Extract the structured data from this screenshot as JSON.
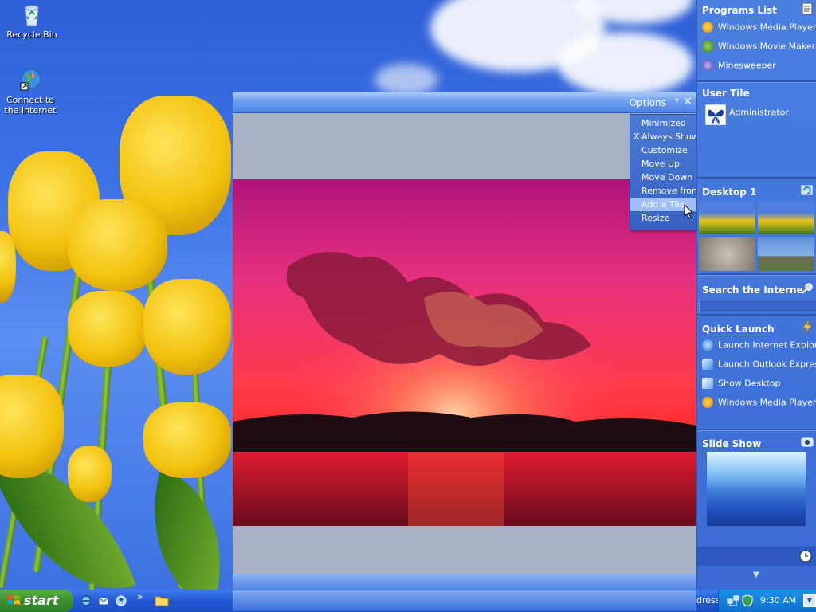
{
  "desktop": {
    "icons": [
      {
        "label": "Recycle Bin"
      },
      {
        "label": "Connect to the Internet"
      }
    ]
  },
  "photo_window": {
    "options_label": "Options",
    "close_glyph": "×",
    "arrow_glyph": "▾"
  },
  "options_menu": {
    "items": [
      {
        "label": "Minimized",
        "checked": false
      },
      {
        "label": "Always Show",
        "checked": true,
        "check_glyph": "X"
      },
      {
        "label": "Customize",
        "checked": false
      },
      {
        "label": "Move Up",
        "checked": false
      },
      {
        "label": "Move Down",
        "checked": false
      },
      {
        "label": "Remove from bar",
        "checked": false
      },
      {
        "label": "Add a Tile",
        "checked": false,
        "submenu": true,
        "highlighted": true
      },
      {
        "label": "Resize",
        "checked": false,
        "submenu": true
      }
    ]
  },
  "sidebar": {
    "programs_list": {
      "title": "Programs List",
      "items": [
        {
          "label": "Windows Media Player",
          "icon": "media-player-icon"
        },
        {
          "label": "Windows Movie Maker",
          "icon": "movie-maker-icon"
        },
        {
          "label": "Minesweeper",
          "icon": "minesweeper-icon"
        }
      ]
    },
    "user_tile": {
      "title": "User Tile",
      "user": "Administrator"
    },
    "desktop_tile": {
      "title": "Desktop 1"
    },
    "search": {
      "title": "Search the Interne"
    },
    "quick_launch": {
      "title": "Quick Launch",
      "items": [
        {
          "label": "Launch Internet Explore",
          "icon": "internet-explorer-icon"
        },
        {
          "label": "Launch Outlook Express",
          "icon": "outlook-express-icon"
        },
        {
          "label": "Show Desktop",
          "icon": "show-desktop-icon"
        },
        {
          "label": "Windows Media Player",
          "icon": "media-player-icon"
        }
      ]
    },
    "slide_show": {
      "title": "Slide Show"
    }
  },
  "taskbar": {
    "start_label": "start",
    "more_glyph": "»",
    "address_label": "dress",
    "clock": "9:30 AM"
  },
  "colors": {
    "accent": "#3b6ad3",
    "menu_highlight": "#9ebef6",
    "start_green": "#3a8f2f"
  }
}
